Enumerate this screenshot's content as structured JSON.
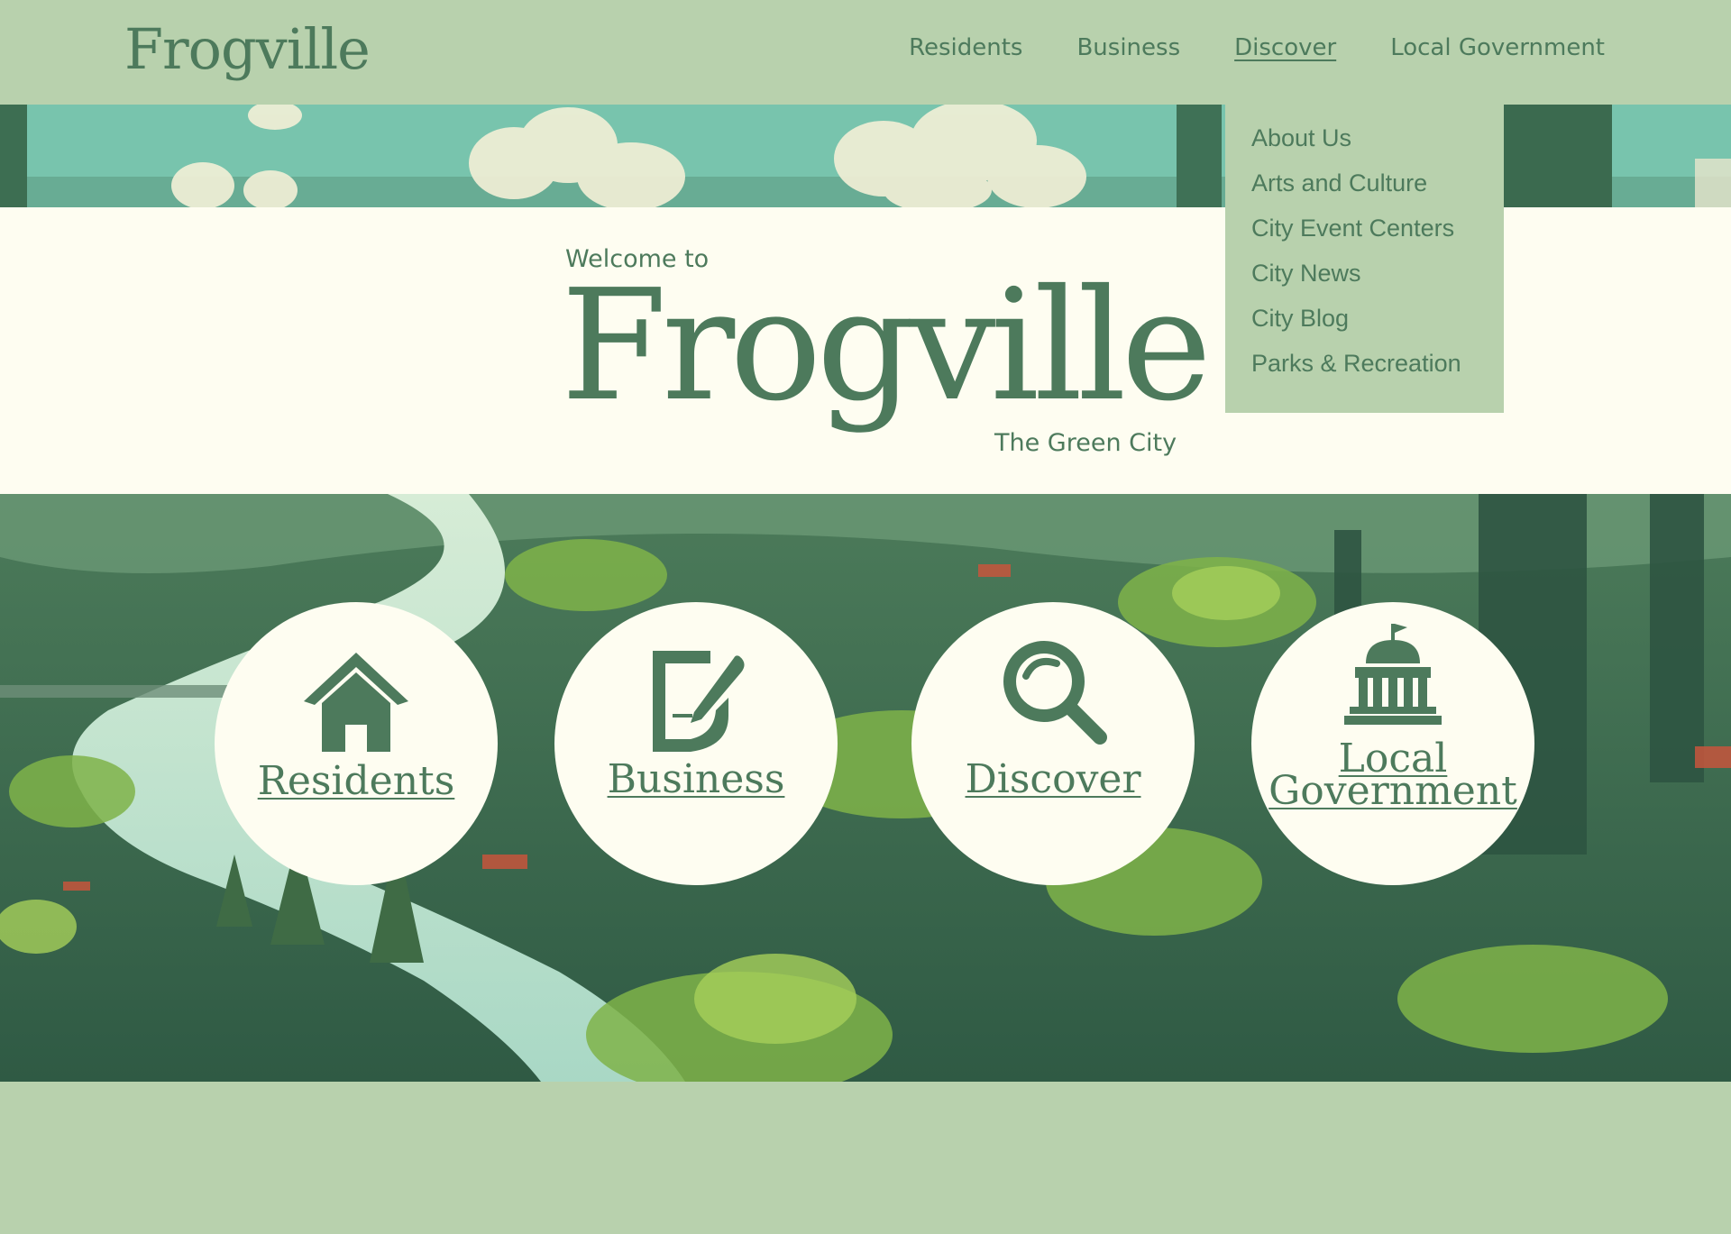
{
  "header": {
    "logo_text": "Frogville",
    "nav": [
      {
        "label": "Residents",
        "active": false
      },
      {
        "label": "Business",
        "active": false
      },
      {
        "label": "Discover",
        "active": true
      },
      {
        "label": "Local Government",
        "active": false
      }
    ]
  },
  "dropdown": {
    "items": [
      "About Us",
      "Arts and Culture",
      "City Event Centers",
      "City News",
      "City Blog",
      "Parks & Recreation"
    ]
  },
  "welcome": {
    "prefix": "Welcome to",
    "title": "Frogville",
    "tagline": "The Green City"
  },
  "quick_links": [
    {
      "label": "Residents",
      "icon": "house-icon"
    },
    {
      "label": "Business",
      "icon": "document-pen-icon"
    },
    {
      "label": "Discover",
      "icon": "magnifier-icon"
    },
    {
      "label_line1": "Local",
      "label_line2": "Government",
      "icon": "capitol-building-icon"
    }
  ],
  "colors": {
    "brand_green": "#4d7a5c",
    "header_bg": "#b8d1ad",
    "cream": "#fefdf1"
  }
}
